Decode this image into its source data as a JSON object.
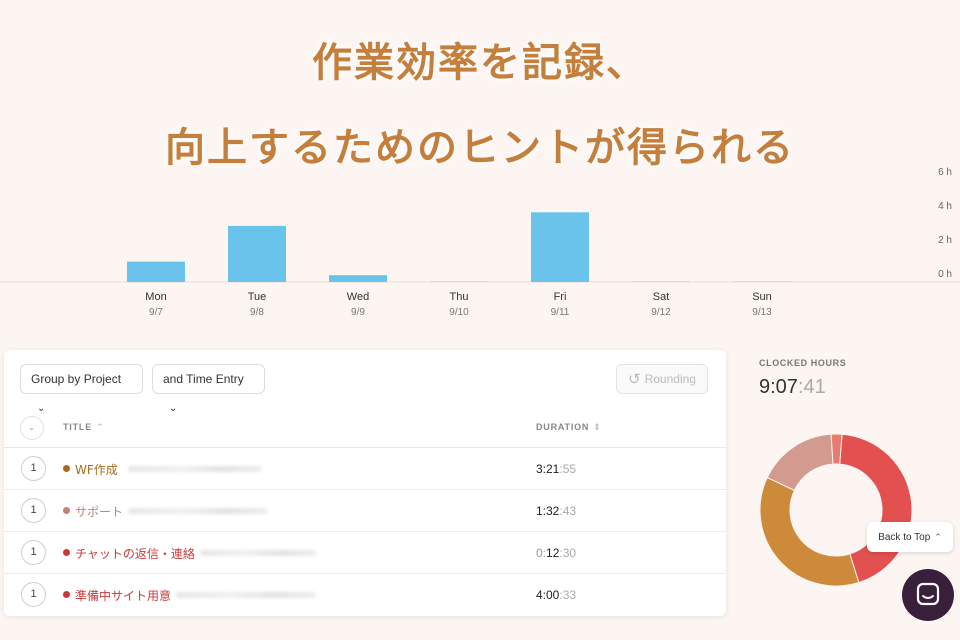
{
  "headline": {
    "line1": "作業効率を記録、",
    "line2": "向上するためのヒントが得られる"
  },
  "chart_data": {
    "type": "bar",
    "categories": [
      "Mon",
      "Tue",
      "Wed",
      "Thu",
      "Fri",
      "Sat",
      "Sun"
    ],
    "dates": [
      "9/7",
      "9/8",
      "9/9",
      "9/10",
      "9/11",
      "9/12",
      "9/13"
    ],
    "values": [
      1.2,
      3.3,
      0.4,
      0,
      4.1,
      0,
      0
    ],
    "yticks": [
      "0 h",
      "2 h",
      "4 h",
      "6 h"
    ],
    "ylim": [
      0,
      6
    ],
    "bar_color": "#6ac3ea"
  },
  "toolbar": {
    "group_by": "Group by Project",
    "and_time": "and Time Entry",
    "rounding": "Rounding"
  },
  "table": {
    "col_title": "TITLE",
    "col_duration": "DURATION",
    "rows": [
      {
        "count": "1",
        "title": "WF作成",
        "color": "#a36d1f",
        "dur_main": "3:21",
        "dur_sec": ":55"
      },
      {
        "count": "1",
        "title": "サポート",
        "color": "#c08377",
        "dur_main": "1:32",
        "dur_sec": ":43"
      },
      {
        "count": "1",
        "title": "チャットの返信・連絡",
        "color": "#c83a3a",
        "dur_zero": "0:",
        "dur_main": "12",
        "dur_sec": ":30"
      },
      {
        "count": "1",
        "title": "準備中サイト用意",
        "color": "#c83a3a",
        "dur_main": "4:00",
        "dur_sec": ":33"
      }
    ]
  },
  "summary": {
    "label": "CLOCKED HOURS",
    "main": "9:07",
    "sec": ":41"
  },
  "donut": {
    "segments": [
      {
        "value": 4.01,
        "color": "#e25050"
      },
      {
        "value": 3.37,
        "color": "#cd8a3a"
      },
      {
        "value": 1.55,
        "color": "#d39a8f"
      },
      {
        "value": 0.21,
        "color": "#e87a6e"
      }
    ]
  },
  "back_to_top": "Back to Top"
}
